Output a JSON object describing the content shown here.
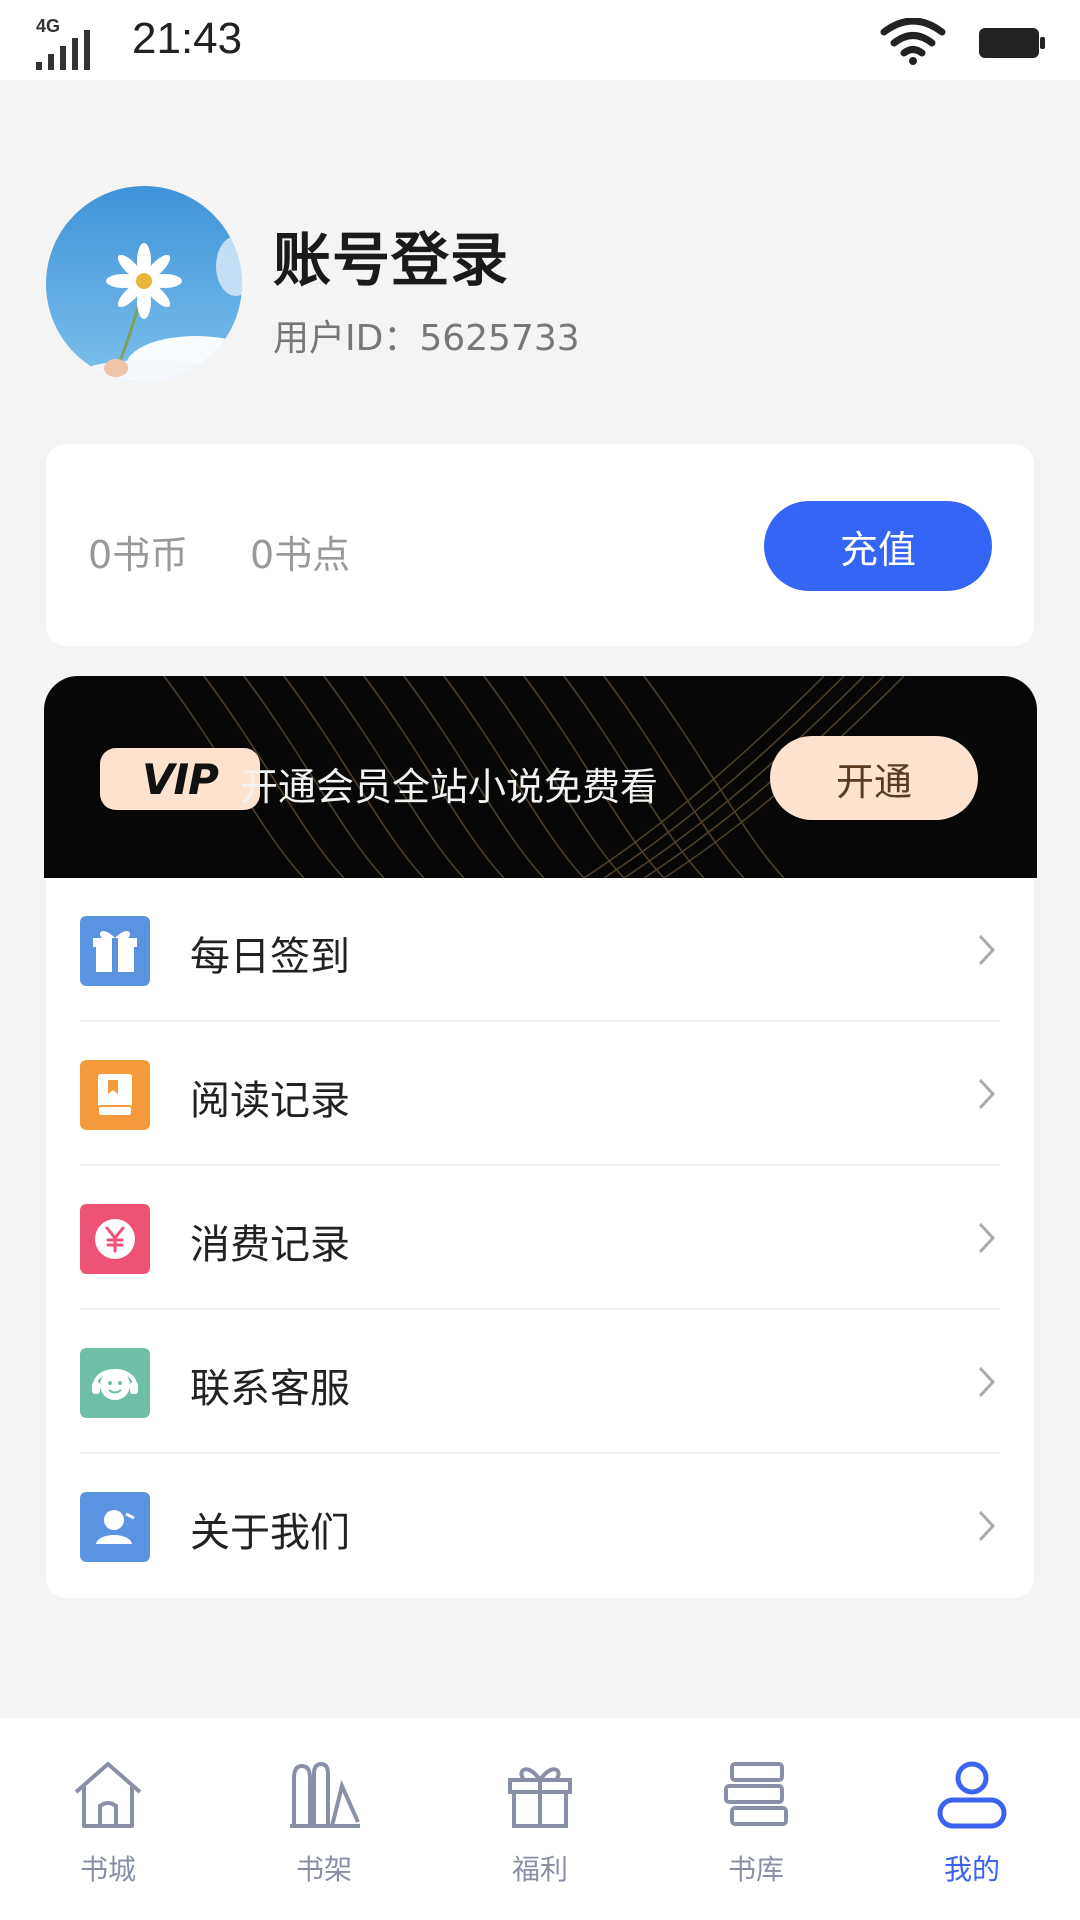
{
  "status_bar": {
    "network": "4G",
    "time": "21:43"
  },
  "profile": {
    "name": "账号登录",
    "user_id": "用户ID：5625733"
  },
  "balance": {
    "book_coins": "0书币",
    "book_points": "0书点",
    "recharge_label": "充值",
    "accent_color": "#3565f5"
  },
  "vip": {
    "badge": "VIP",
    "promo_text": "开通会员全站小说免费看",
    "open_label": "开通"
  },
  "menu": {
    "items": [
      {
        "label": "每日签到",
        "icon": "gift-icon",
        "color": "#5a93e0"
      },
      {
        "label": "阅读记录",
        "icon": "book-icon",
        "color": "#f49a3c"
      },
      {
        "label": "消费记录",
        "icon": "yuan-icon",
        "color": "#ee5274"
      },
      {
        "label": "联系客服",
        "icon": "headset-icon",
        "color": "#6fbea8"
      },
      {
        "label": "关于我们",
        "icon": "person-icon",
        "color": "#5a93e0"
      }
    ]
  },
  "tabs": [
    {
      "label": "书城",
      "icon": "home-icon",
      "active": false
    },
    {
      "label": "书架",
      "icon": "bookshelf-icon",
      "active": false
    },
    {
      "label": "福利",
      "icon": "gift-icon",
      "active": false
    },
    {
      "label": "书库",
      "icon": "books-stack-icon",
      "active": false
    },
    {
      "label": "我的",
      "icon": "user-icon",
      "active": true
    }
  ]
}
